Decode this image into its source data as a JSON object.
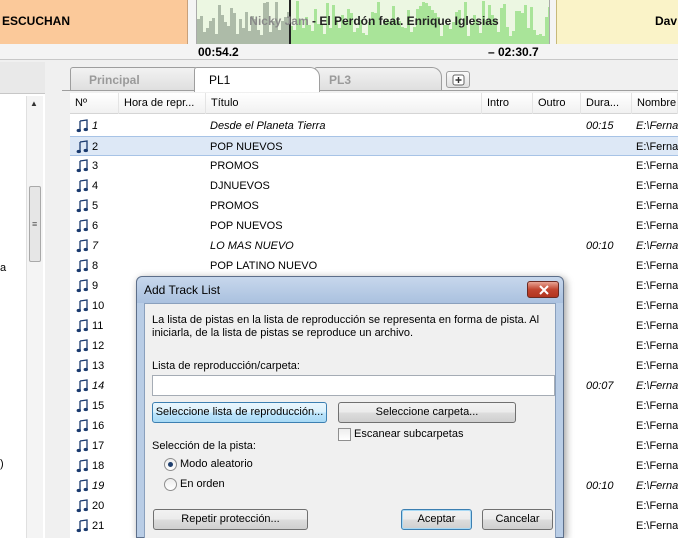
{
  "top": {
    "listen_banner": "ESCUCHAN",
    "now_playing_artist": "Nicky Jam",
    "now_playing_rest": " - El Perdón feat. Enrique Iglesias",
    "next_banner": "Dav",
    "elapsed": "00:54.2",
    "remaining": "– 02:30.7"
  },
  "left_panel": {
    "fragment_1": "a",
    "fragment_2": ")"
  },
  "tabs": [
    {
      "label": "Principal",
      "active": false
    },
    {
      "label": "PL1",
      "active": true
    },
    {
      "label": "PL3",
      "active": false
    }
  ],
  "columns": [
    "Nº",
    "Hora de repr...",
    "Título",
    "Intro",
    "Outro",
    "Dura...",
    "Nombre"
  ],
  "rows": [
    {
      "num": "1",
      "title": "Desde el Planeta Tierra",
      "duration": "00:15",
      "name": "E:\\Ferna",
      "italic": true
    },
    {
      "num": "2",
      "title": "POP NUEVOS",
      "duration": "",
      "name": "E:\\Ferna",
      "italic": false,
      "selected": true
    },
    {
      "num": "3",
      "title": "PROMOS",
      "duration": "",
      "name": "E:\\Ferna",
      "italic": false
    },
    {
      "num": "4",
      "title": "DJNUEVOS",
      "duration": "",
      "name": "E:\\Ferna",
      "italic": false
    },
    {
      "num": "5",
      "title": "PROMOS",
      "duration": "",
      "name": "E:\\Ferna",
      "italic": false
    },
    {
      "num": "6",
      "title": "POP NUEVOS",
      "duration": "",
      "name": "E:\\Ferna",
      "italic": false
    },
    {
      "num": "7",
      "title": "LO MAS NUEVO",
      "duration": "00:10",
      "name": "E:\\Ferna",
      "italic": true
    },
    {
      "num": "8",
      "title": "POP LATINO NUEVO",
      "duration": "",
      "name": "E:\\Ferna",
      "italic": false
    },
    {
      "num": "9",
      "title": "",
      "duration": "",
      "name": "E:\\Ferna",
      "italic": false
    },
    {
      "num": "10",
      "title": "",
      "duration": "",
      "name": "E:\\Ferna",
      "italic": false
    },
    {
      "num": "11",
      "title": "",
      "duration": "",
      "name": "E:\\Ferna",
      "italic": false
    },
    {
      "num": "12",
      "title": "",
      "duration": "",
      "name": "E:\\Ferna",
      "italic": false
    },
    {
      "num": "13",
      "title": "",
      "duration": "",
      "name": "E:\\Ferna",
      "italic": false
    },
    {
      "num": "14",
      "title": "",
      "duration": "00:07",
      "name": "E:\\Ferna",
      "italic": true
    },
    {
      "num": "15",
      "title": "",
      "duration": "",
      "name": "E:\\Ferna",
      "italic": false
    },
    {
      "num": "16",
      "title": "",
      "duration": "",
      "name": "E:\\Ferna",
      "italic": false
    },
    {
      "num": "17",
      "title": "",
      "duration": "",
      "name": "E:\\Ferna",
      "italic": false
    },
    {
      "num": "18",
      "title": "",
      "duration": "",
      "name": "E:\\Ferna",
      "italic": false
    },
    {
      "num": "19",
      "title": "",
      "duration": "00:10",
      "name": "E:\\Ferna",
      "italic": true
    },
    {
      "num": "20",
      "title": "",
      "duration": "",
      "name": "E:\\Ferna",
      "italic": false
    },
    {
      "num": "21",
      "title": "",
      "duration": "",
      "name": "E:\\Ferna",
      "italic": false
    }
  ],
  "dialog": {
    "title": "Add Track List",
    "description": "La lista de pistas en la lista de reproducción se representa en forma de pista. Al iniciarla, de la lista de pistas se reproduce un archivo.",
    "path_label": "Lista de reproducción/carpeta:",
    "path_value": "",
    "select_playlist": "Seleccione lista de reproducción...",
    "select_folder": "Seleccione carpeta...",
    "scan_subfolders": "Escanear subcarpetas",
    "scan_subfolders_checked": false,
    "track_selection_label": "Selección de la pista:",
    "random_mode": "Modo aleatorio",
    "in_order": "En orden",
    "selected_mode": "random",
    "repeat_protection": "Repetir protección...",
    "accept": "Aceptar",
    "cancel": "Cancelar"
  },
  "colors": {
    "listen_banner": "#fbc99a",
    "next_banner": "#faf3c8",
    "wave_played": "#7a8a78",
    "wave_unplayed": "#9ee08c",
    "selected_row": "#dde8f6",
    "dialog_frame": "#b9cde6"
  },
  "icons": {
    "row_icon": "music-note-icon",
    "close": "close-icon",
    "add_tab": "add-tab-icon"
  }
}
